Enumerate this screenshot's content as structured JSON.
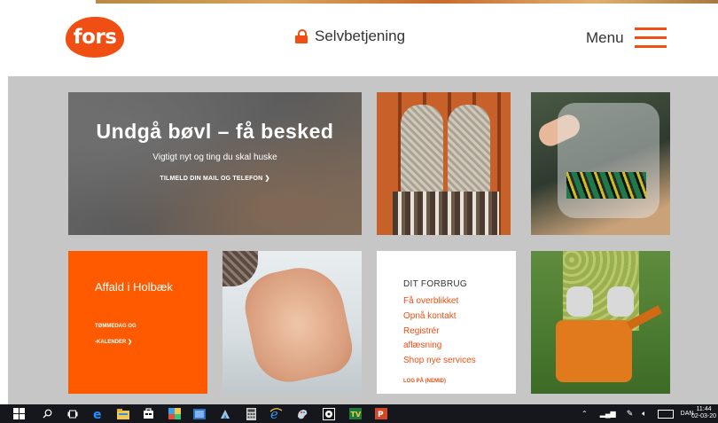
{
  "header": {
    "logo_text": "fors",
    "self_service_label": "Selvbetjening",
    "menu_label": "Menu"
  },
  "tiles": {
    "hero": {
      "title": "Undgå bøvl – få besked",
      "subtitle": "Vigtigt nyt og ting du skal huske",
      "link": "TILMELD DIN MAIL OG TELEFON ❯"
    },
    "waste": {
      "title": "Affald i Holbæk",
      "link_line1": "TØMMEDAG OG",
      "link_line2": "-KALENDER ❯"
    },
    "consumption": {
      "heading": "DIT FORBRUG",
      "items": [
        "Få overblikket",
        "Opnå kontakt",
        "Registrér",
        "aflæsning",
        "Shop nye services"
      ],
      "footer": "LOG PÅ (NEMID)"
    }
  },
  "taskbar": {
    "language": "DAN",
    "time": "11:44",
    "date": "02-03-20"
  },
  "colors": {
    "brand_orange": "#f04e12",
    "tile_orange": "#ff5a00",
    "content_bg": "#c6c6c6",
    "taskbar_bg": "#15171c"
  }
}
